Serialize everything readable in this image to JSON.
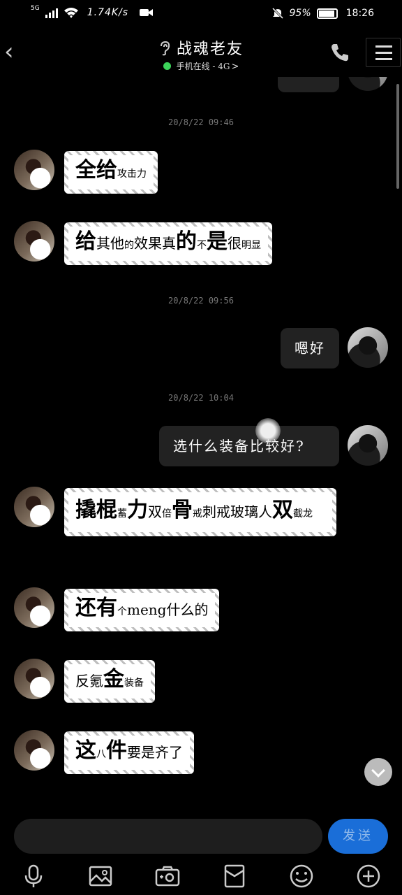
{
  "status_bar": {
    "network": "5G",
    "speed": "1.74K/s",
    "battery": "95%",
    "time": "18:26"
  },
  "header": {
    "title": "战魂老友",
    "status": "手机在线 - 4G",
    "status_arrow": ">"
  },
  "timestamps": [
    "20/8/22 09:46",
    "20/8/22 09:56",
    "20/8/22 10:04"
  ],
  "messages": [
    {
      "side": "left",
      "parts": [
        [
          "全",
          "lg"
        ],
        [
          "给",
          "lg"
        ],
        [
          "攻击力",
          "sm"
        ]
      ]
    },
    {
      "side": "left",
      "parts": [
        [
          "给",
          "lg"
        ],
        [
          "其他",
          ""
        ],
        [
          "的",
          "sm"
        ],
        [
          "效果真",
          ""
        ],
        [
          "的",
          "lg"
        ],
        [
          "不",
          "sm"
        ],
        [
          "是",
          "lg"
        ],
        [
          "很",
          ""
        ],
        [
          "明显",
          "sm"
        ]
      ]
    },
    {
      "side": "right",
      "text": "嗯好"
    },
    {
      "side": "right",
      "text": "选什么装备比较好?"
    },
    {
      "side": "left",
      "parts": [
        [
          "撬棍",
          "lg"
        ],
        [
          "蓄",
          "sm"
        ],
        [
          "力",
          "lg"
        ],
        [
          "双",
          ""
        ],
        [
          "倍",
          "sm"
        ],
        [
          "骨",
          "lg"
        ],
        [
          "戒",
          "sm"
        ],
        [
          "刺戒玻璃人",
          ""
        ],
        [
          "双",
          "lg"
        ],
        [
          "截龙",
          "sm"
        ]
      ]
    },
    {
      "side": "left",
      "parts": [
        [
          "还",
          "lg"
        ],
        [
          "有",
          "lg"
        ],
        [
          "个",
          "sm"
        ],
        [
          "meng什么的",
          ""
        ]
      ]
    },
    {
      "side": "left",
      "parts": [
        [
          "反氪",
          ""
        ],
        [
          "金",
          "lg"
        ],
        [
          "装备",
          "sm"
        ]
      ]
    },
    {
      "side": "left",
      "parts": [
        [
          "这",
          "lg"
        ],
        [
          "八",
          "sm"
        ],
        [
          "件",
          "lg"
        ],
        [
          "要是齐了",
          ""
        ]
      ]
    }
  ],
  "input": {
    "placeholder": "",
    "send_label": "发送"
  },
  "toolbar": [
    "mic-icon",
    "image-icon",
    "camera-icon",
    "red-packet-icon",
    "emoji-icon",
    "plus-icon"
  ]
}
